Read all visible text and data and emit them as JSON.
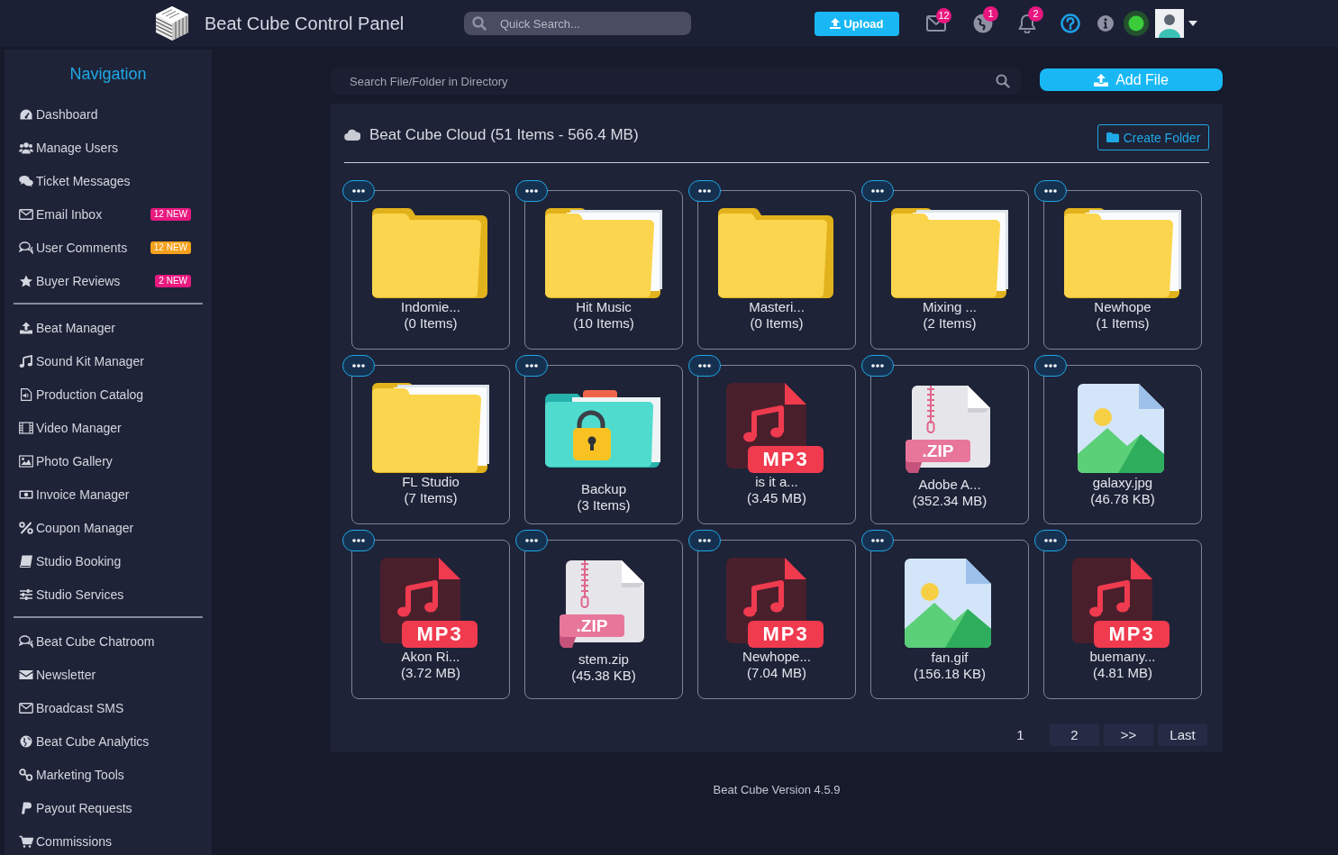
{
  "header": {
    "title": "Beat Cube Control Panel",
    "search": {
      "placeholder": "Quick Search..."
    },
    "upload_button": "Upload",
    "notifications": [
      {
        "count": "12"
      },
      {
        "count": "1"
      },
      {
        "count": "2"
      }
    ],
    "status": {
      "online": true
    }
  },
  "sidebar": {
    "title": "Navigation",
    "groups": [
      {
        "items": [
          {
            "label": "Dashboard"
          },
          {
            "label": "Manage Users"
          },
          {
            "label": "Ticket Messages"
          },
          {
            "label": "Email Inbox",
            "badge": {
              "text": "12 NEW",
              "color": "#e8197f"
            }
          },
          {
            "label": "User Comments",
            "badge": {
              "text": "12 NEW",
              "color": "#f5a11c"
            }
          },
          {
            "label": "Buyer Reviews",
            "badge": {
              "text": "2 NEW",
              "color": "#e8197f"
            }
          }
        ]
      },
      {
        "items": [
          {
            "label": "Beat Manager"
          },
          {
            "label": "Sound Kit Manager"
          },
          {
            "label": "Production Catalog"
          },
          {
            "label": "Video Manager"
          },
          {
            "label": "Photo Gallery"
          },
          {
            "label": "Invoice Manager"
          },
          {
            "label": "Coupon Manager"
          },
          {
            "label": "Studio Booking"
          },
          {
            "label": "Studio Services"
          }
        ]
      },
      {
        "items": [
          {
            "label": "Beat Cube Chatroom"
          },
          {
            "label": "Newsletter"
          },
          {
            "label": "Broadcast SMS"
          },
          {
            "label": "Beat Cube Analytics"
          },
          {
            "label": "Marketing Tools"
          },
          {
            "label": "Payout Requests"
          },
          {
            "label": "Commissions"
          }
        ]
      }
    ]
  },
  "toolbar": {
    "search": {
      "placeholder": "Search File/Folder in Directory"
    },
    "add_button": "Add File"
  },
  "browser": {
    "title": "Beat Cube Cloud (51 Items - 566.4 MB)",
    "create_button": "Create Folder",
    "items": [
      {
        "kind": "folder",
        "papers": false,
        "name": "Indomie...",
        "detail": "(0 Items)"
      },
      {
        "kind": "folder",
        "papers": true,
        "name": "Hit Music",
        "detail": "(10 Items)"
      },
      {
        "kind": "folder",
        "papers": false,
        "name": "Masteri...",
        "detail": "(0 Items)"
      },
      {
        "kind": "folder",
        "papers": true,
        "name": "Mixing ...",
        "detail": "(2 Items)"
      },
      {
        "kind": "folder",
        "papers": true,
        "name": "Newhope",
        "detail": "(1 Items)"
      },
      {
        "kind": "folder",
        "papers": true,
        "name": "FL Studio",
        "detail": "(7 Items)"
      },
      {
        "kind": "locked",
        "name": "Backup",
        "detail": "(3 Items)"
      },
      {
        "kind": "mp3",
        "type_label": "MP3",
        "name": "is it a...",
        "detail": "(3.45 MB)"
      },
      {
        "kind": "zip",
        "type_label": ".ZIP",
        "name": "Adobe A...",
        "detail": "(352.34 MB)"
      },
      {
        "kind": "image",
        "name": "galaxy.jpg",
        "detail": "(46.78 KB)"
      },
      {
        "kind": "mp3",
        "type_label": "MP3",
        "name": "Akon Ri...",
        "detail": "(3.72 MB)"
      },
      {
        "kind": "zip",
        "type_label": ".ZIP",
        "name": "stem.zip",
        "detail": "(45.38 KB)"
      },
      {
        "kind": "mp3",
        "type_label": "MP3",
        "name": "Newhope...",
        "detail": "(7.04 MB)"
      },
      {
        "kind": "image",
        "name": "fan.gif",
        "detail": "(156.18 KB)"
      },
      {
        "kind": "mp3",
        "type_label": "MP3",
        "name": "buemany...",
        "detail": "(4.81 MB)"
      }
    ],
    "pagination": [
      {
        "label": "1",
        "selected": true
      },
      {
        "label": "2",
        "selected": false
      },
      {
        "label": ">>",
        "selected": false
      },
      {
        "label": "Last",
        "selected": false
      }
    ]
  },
  "footer": "Beat Cube Version 4.5.9"
}
